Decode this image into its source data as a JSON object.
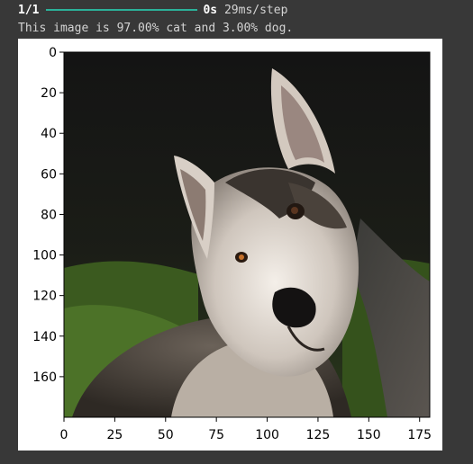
{
  "progress": {
    "steps_label": "1/1",
    "progress_fraction": 1.0,
    "time_label": "0s",
    "rate_label": "29ms/step"
  },
  "prediction_text": "This image is 97.00% cat and 3.00% dog.",
  "colors": {
    "background": "#383838",
    "progress_bar": "#2bb29a",
    "text": "#d4d4d4"
  },
  "chart_data": {
    "type": "image",
    "title": "",
    "xlabel": "",
    "ylabel": "",
    "xlim": [
      0,
      180
    ],
    "ylim": [
      180,
      0
    ],
    "x_ticks": [
      0,
      25,
      50,
      75,
      100,
      125,
      150,
      175
    ],
    "y_ticks": [
      0,
      20,
      40,
      60,
      80,
      100,
      120,
      140,
      160
    ],
    "image_subject": "husky-dog-photo"
  }
}
